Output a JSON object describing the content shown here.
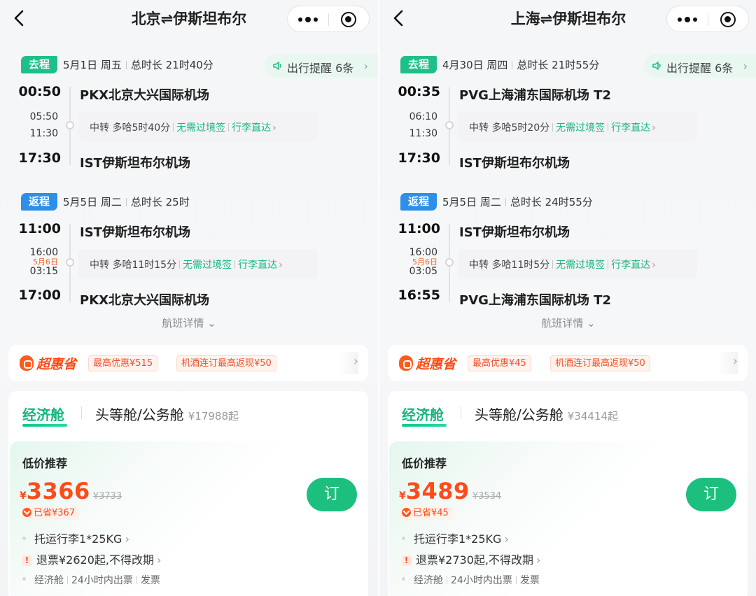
{
  "panels": [
    {
      "title": "北京⇌伊斯坦布尔",
      "outbound": {
        "tag": "去程",
        "date": "5月1日 周五",
        "duration": "总时长 21时40分",
        "reminder": "出行提醒 6条",
        "dep_time": "00:50",
        "dep_airport": "PKX北京大兴国际机场",
        "transfer_arr": "05:50",
        "transfer_next_day": "",
        "transfer_dep": "11:30",
        "transfer_text": "中转 多哈5时40分",
        "transfer_visa": "无需过境签",
        "transfer_baggage": "行李直达",
        "arr_time": "17:30",
        "arr_airport": "IST伊斯坦布尔机场"
      },
      "return": {
        "tag": "返程",
        "date": "5月5日 周二",
        "duration": "总时长 25时",
        "dep_time": "11:00",
        "dep_airport": "IST伊斯坦布尔机场",
        "transfer_arr": "16:00",
        "transfer_next_day": "5月6日",
        "transfer_dep": "03:15",
        "transfer_text": "中转 多哈11时15分",
        "transfer_visa": "无需过境签",
        "transfer_baggage": "行李直达",
        "arr_time": "17:00",
        "arr_airport": "PKX北京大兴国际机场"
      },
      "flight_details": "航班详情",
      "promo": {
        "logo": "超惠省",
        "chip1": "最高优惠¥515",
        "chip2": "机酒连订最高返现¥50"
      },
      "cabin": {
        "tab_economy": "经济舱",
        "tab_first": "头等舱/公务舱",
        "first_price": "¥17988起",
        "offer_title": "低价推荐",
        "currency": "¥",
        "price": "3366",
        "original_price": "¥3733",
        "saved": "已省¥367",
        "book": "订",
        "baggage": "托运行李1*25KG",
        "refund": "退票¥2620起,不得改期",
        "meta_class": "经济舱",
        "meta_ticket": "24小时内出票",
        "meta_invoice": "发票"
      }
    },
    {
      "title": "上海⇌伊斯坦布尔",
      "outbound": {
        "tag": "去程",
        "date": "4月30日 周四",
        "duration": "总时长 21时55分",
        "reminder": "出行提醒 6条",
        "dep_time": "00:35",
        "dep_airport": "PVG上海浦东国际机场 T2",
        "transfer_arr": "06:10",
        "transfer_next_day": "",
        "transfer_dep": "11:30",
        "transfer_text": "中转 多哈5时20分",
        "transfer_visa": "无需过境签",
        "transfer_baggage": "行李直达",
        "arr_time": "17:30",
        "arr_airport": "IST伊斯坦布尔机场"
      },
      "return": {
        "tag": "返程",
        "date": "5月5日 周二",
        "duration": "总时长 24时55分",
        "dep_time": "11:00",
        "dep_airport": "IST伊斯坦布尔机场",
        "transfer_arr": "16:00",
        "transfer_next_day": "5月6日",
        "transfer_dep": "03:05",
        "transfer_text": "中转 多哈11时5分",
        "transfer_visa": "无需过境签",
        "transfer_baggage": "行李直达",
        "arr_time": "16:55",
        "arr_airport": "PVG上海浦东国际机场 T2"
      },
      "flight_details": "航班详情",
      "promo": {
        "logo": "超惠省",
        "chip1": "最高优惠¥45",
        "chip2": "机酒连订最高返现¥50"
      },
      "cabin": {
        "tab_economy": "经济舱",
        "tab_first": "头等舱/公务舱",
        "first_price": "¥34414起",
        "offer_title": "低价推荐",
        "currency": "¥",
        "price": "3489",
        "original_price": "¥3534",
        "saved": "已省¥45",
        "book": "订",
        "baggage": "托运行李1*25KG",
        "refund": "退票¥2730起,不得改期",
        "meta_class": "经济舱",
        "meta_ticket": "24小时内出票",
        "meta_invoice": "发票"
      }
    }
  ],
  "colors": {
    "accent_green": "#1dbf7e",
    "tag_blue": "#2e8fe8",
    "price_orange": "#ff4a1a"
  },
  "icons": [
    "back-arrow-icon",
    "more-dots-icon",
    "mini-program-close-icon",
    "speaker-icon",
    "chevron-right-icon",
    "chevron-down-icon",
    "coupon-badge-icon",
    "warning-icon",
    "saved-badge-icon"
  ]
}
